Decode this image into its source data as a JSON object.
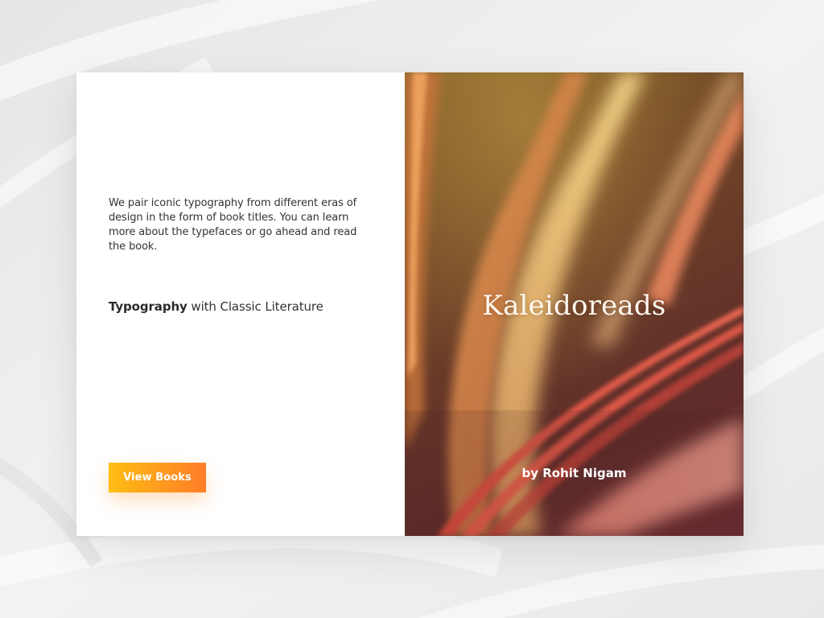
{
  "left": {
    "description": "We pair iconic typography from different eras of design in the form of book titles. You can learn more about the typefaces or go ahead and read the book.",
    "tagline_strong": "Typography",
    "tagline_rest": " with Classic Literature",
    "button_label": "View Books"
  },
  "cover": {
    "title": "Kaleidoreads",
    "author": "by Rohit Nigam"
  },
  "colors": {
    "button_start": "#ffbe12",
    "button_end": "#ff7d27",
    "page_background": "#eeeeee",
    "card_background": "#ffffff"
  }
}
